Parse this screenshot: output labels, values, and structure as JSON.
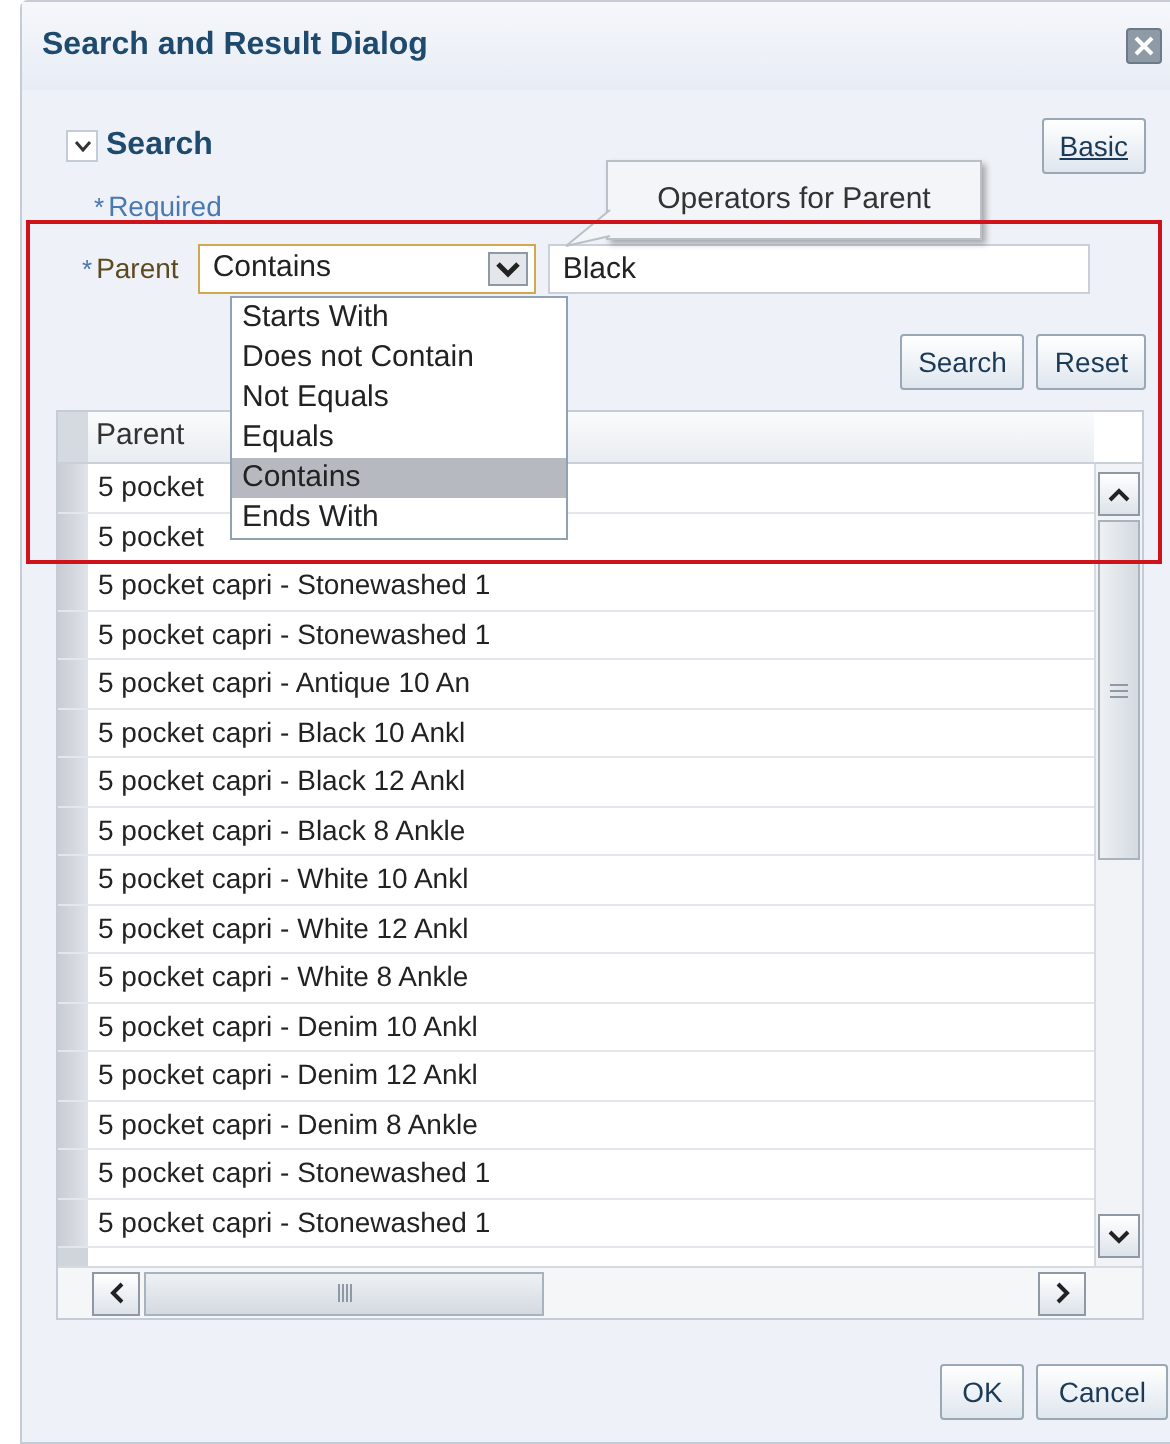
{
  "window": {
    "title": "Search and Result Dialog"
  },
  "search": {
    "title": "Search",
    "expanded": true,
    "required_note": "Required",
    "required_mark": "*",
    "mode_button": "Basic",
    "tooltip": "Operators for Parent",
    "field": {
      "label": "Parent",
      "required_mark": "*",
      "operator": "Contains",
      "value": "Black"
    },
    "operators": [
      {
        "label": "Starts With",
        "selected": false
      },
      {
        "label": "Does not Contain",
        "selected": false
      },
      {
        "label": "Not Equals",
        "selected": false
      },
      {
        "label": "Equals",
        "selected": false
      },
      {
        "label": "Contains",
        "selected": true
      },
      {
        "label": "Ends With",
        "selected": false
      }
    ],
    "buttons": [
      "Search",
      "Reset"
    ]
  },
  "table": {
    "columns": [
      "Parent"
    ],
    "rows": [
      "5 pocket",
      "5 pocket",
      "5 pocket capri - Stonewashed 1",
      "5 pocket capri - Stonewashed 1",
      "5 pocket capri - Antique 10 An",
      "5 pocket capri - Black 10 Ankl",
      "5 pocket capri - Black 12 Ankl",
      "5 pocket capri - Black 8 Ankle",
      "5 pocket capri - White 10 Ankl",
      "5 pocket capri - White 12 Ankl",
      "5 pocket capri - White 8 Ankle",
      "5 pocket capri - Denim 10 Ankl",
      "5 pocket capri - Denim 12 Ankl",
      "5 pocket capri - Denim 8 Ankle",
      "5 pocket capri - Stonewashed 1",
      "5 pocket capri - Stonewashed 1"
    ]
  },
  "buttons": [
    "OK",
    "Cancel"
  ]
}
